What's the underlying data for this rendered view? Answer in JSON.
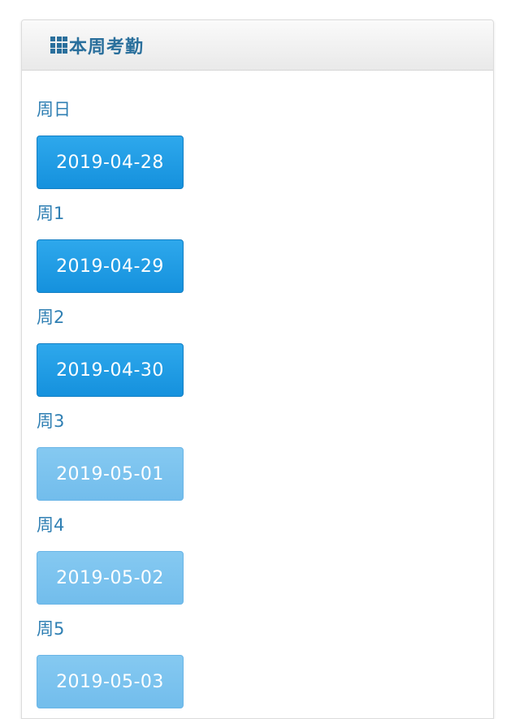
{
  "panel": {
    "title": "本周考勤",
    "title_icon": "grid-icon"
  },
  "colors": {
    "title": "#2a6f9c",
    "label": "#2f7fb3",
    "button_active": "#1f9ce6",
    "button_future": "#7cc3ef"
  },
  "days": [
    {
      "label": "周日",
      "date": "2019-04-28",
      "state": "active"
    },
    {
      "label": "周1",
      "date": "2019-04-29",
      "state": "active"
    },
    {
      "label": "周2",
      "date": "2019-04-30",
      "state": "active"
    },
    {
      "label": "周3",
      "date": "2019-05-01",
      "state": "future"
    },
    {
      "label": "周4",
      "date": "2019-05-02",
      "state": "future"
    },
    {
      "label": "周5",
      "date": "2019-05-03",
      "state": "future"
    }
  ]
}
